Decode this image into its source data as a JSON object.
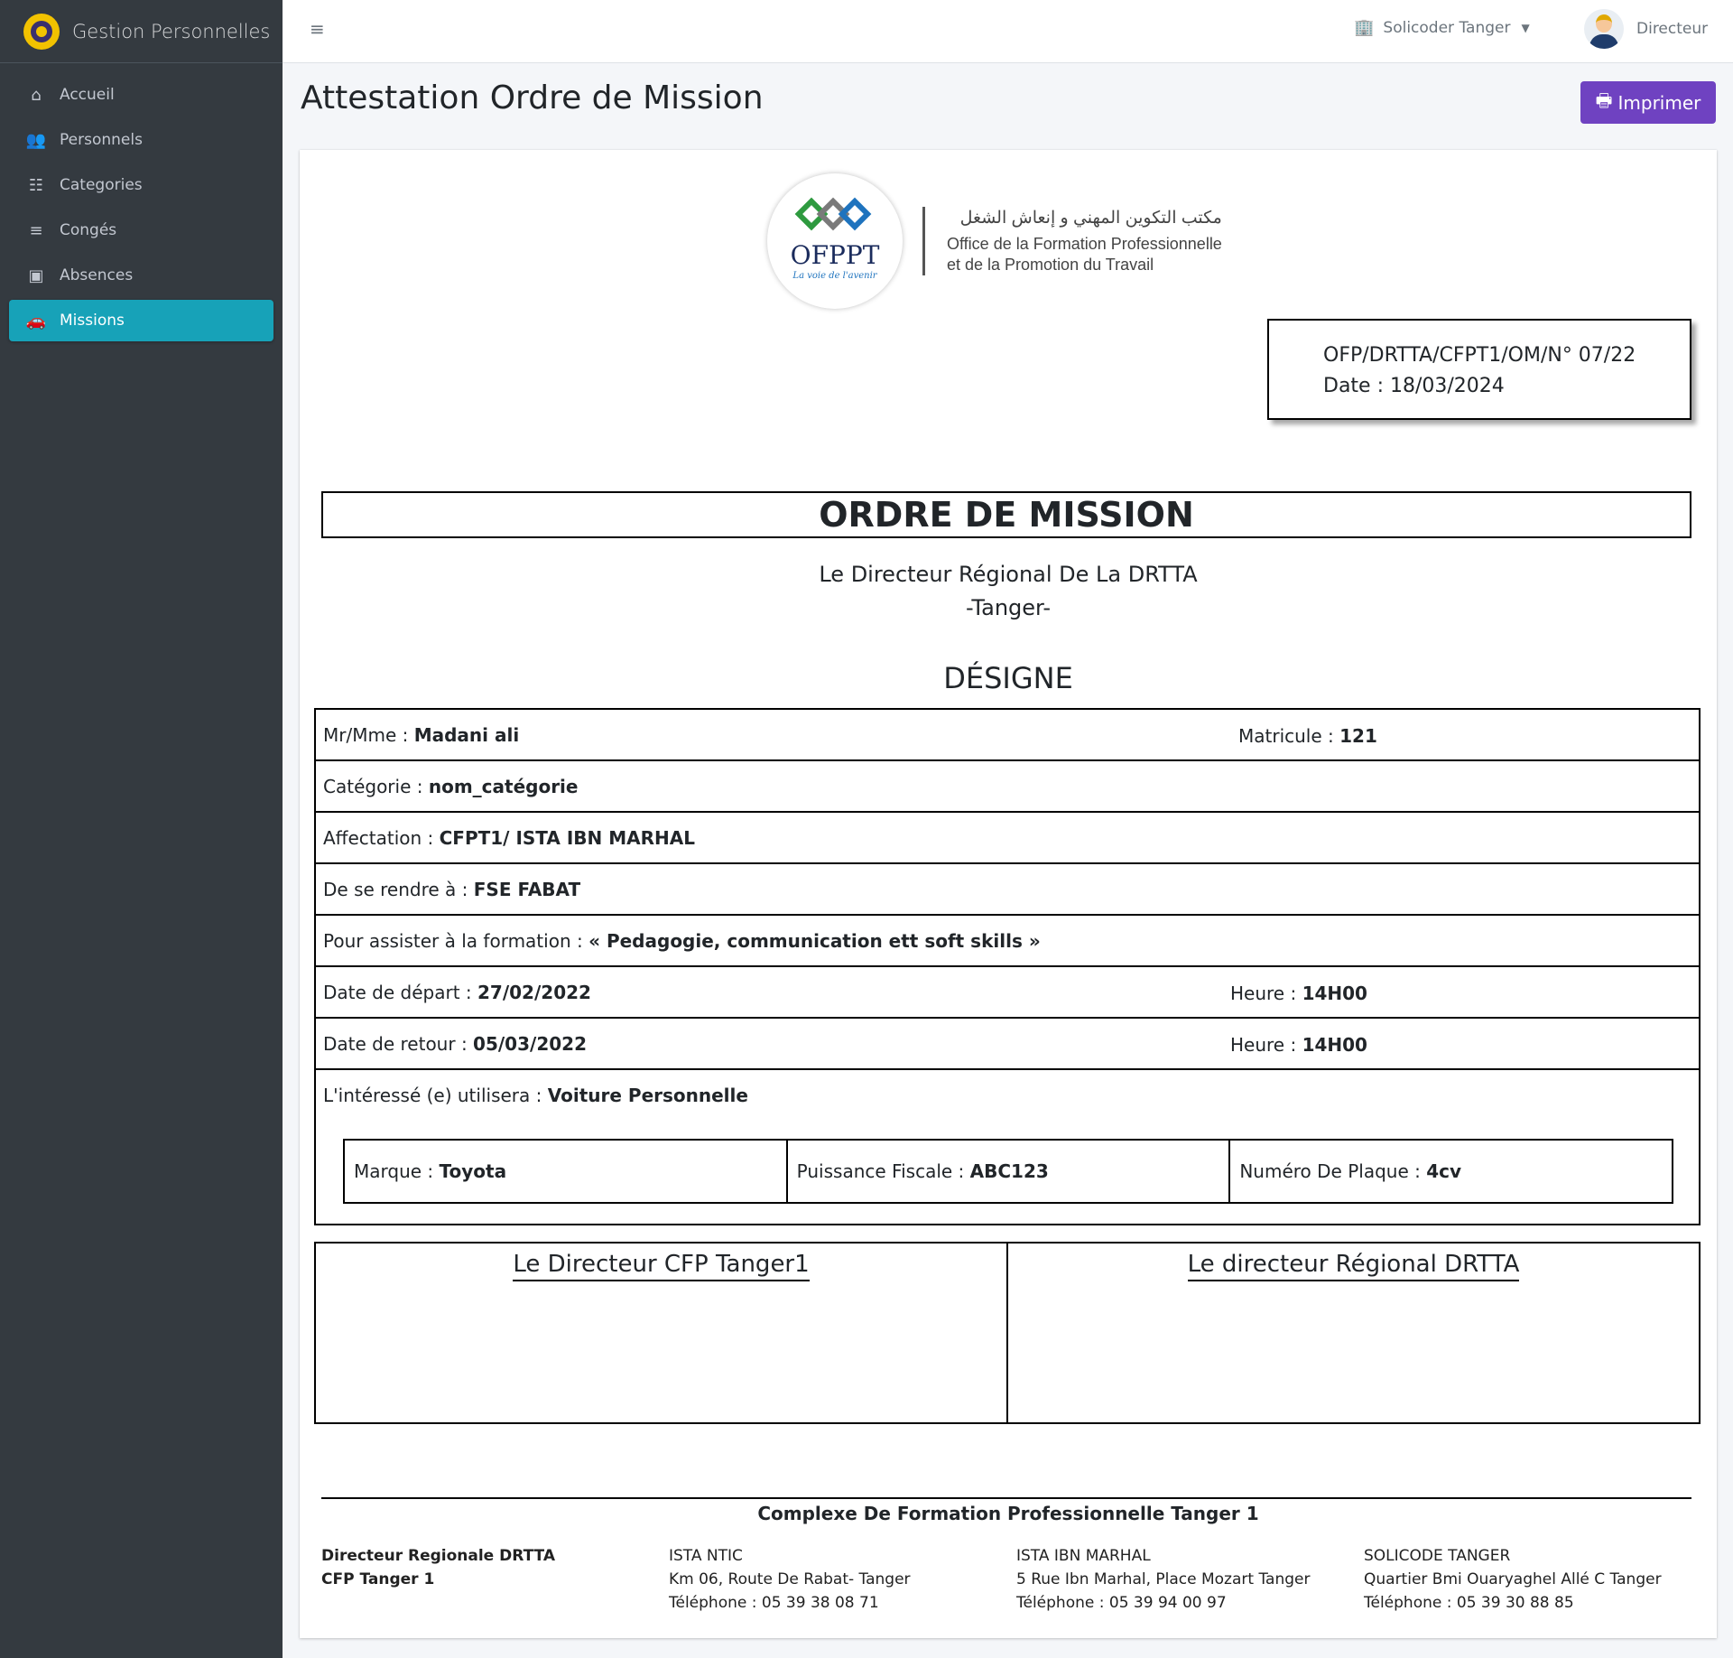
{
  "brand": {
    "name": "Gestion Personnelles"
  },
  "sidebar": {
    "items": [
      {
        "label": "Accueil",
        "icon": "home-icon"
      },
      {
        "label": "Personnels",
        "icon": "users-icon"
      },
      {
        "label": "Categories",
        "icon": "list-icon"
      },
      {
        "label": "Congés",
        "icon": "bars-icon"
      },
      {
        "label": "Absences",
        "icon": "calendar-icon"
      },
      {
        "label": "Missions",
        "icon": "car-icon",
        "active": true
      }
    ]
  },
  "topbar": {
    "location": "Solicoder Tanger",
    "user_role": "Directeur"
  },
  "page": {
    "title": "Attestation Ordre de Mission",
    "print_label": "Imprimer"
  },
  "document": {
    "logo": {
      "name": "OFPPT",
      "tagline": "La voie de l'avenir",
      "arabic": "مكتب التكوين المهني و إنعاش الشغل",
      "french_line1": "Office de la Formation Professionnelle",
      "french_line2": "et de la Promotion du Travail"
    },
    "reference": "OFP/DRTTA/CFPT1/OM/N° 07/22",
    "date_line": "Date : 18/03/2024",
    "title": "ORDRE DE MISSION",
    "director_line1": "Le Directeur Régional De La DRTTA",
    "director_line2": "-Tanger-",
    "designe": "DÉSIGNE",
    "fields": {
      "name_label": "Mr/Mme : ",
      "name_value": "Madani ali",
      "matricule_label": "Matricule : ",
      "matricule_value": "121",
      "categorie_label": "Catégorie : ",
      "categorie_value": "nom_catégorie",
      "affectation_label": "Affectation : ",
      "affectation_value": "CFPT1/ ISTA IBN MARHAL",
      "destination_label": "De se rendre à : ",
      "destination_value": "FSE FABAT",
      "formation_label": "Pour assister à la formation : ",
      "formation_value": "« Pedagogie, communication ett soft skills »",
      "depart_label": "Date de départ : ",
      "depart_value": "27/02/2022",
      "depart_heure_label": "Heure : ",
      "depart_heure_value": "14H00",
      "retour_label": "Date de retour : ",
      "retour_value": "05/03/2022",
      "retour_heure_label": "Heure : ",
      "retour_heure_value": "14H00",
      "transport_label": "L'intéressé (e) utilisera : ",
      "transport_value": "Voiture Personnelle",
      "marque_label": "Marque : ",
      "marque_value": "Toyota",
      "puissance_label": "Puissance Fiscale : ",
      "puissance_value": "ABC123",
      "plaque_label": "Numéro De Plaque : ",
      "plaque_value": "4cv"
    },
    "signatures": {
      "left": "Le Directeur CFP Tanger1",
      "right": "Le directeur Régional DRTTA"
    },
    "footer": {
      "title": "Complexe De Formation Professionnelle Tanger 1",
      "col1_line1": "Directeur Regionale DRTTA",
      "col1_line2": "CFP Tanger 1",
      "col2_line1": "ISTA NTIC",
      "col2_line2": "Km 06, Route De Rabat- Tanger",
      "col2_line3": "Téléphone : 05 39 38 08 71",
      "col3_line1": "ISTA IBN MARHAL",
      "col3_line2": "5 Rue Ibn Marhal, Place Mozart Tanger",
      "col3_line3": "Téléphone : 05 39 94 00 97",
      "col4_line1": "SOLICODE TANGER",
      "col4_line2": "Quartier Bmi Ouaryaghel Allé C Tanger",
      "col4_line3": "Téléphone : 05 39 30 88 85"
    }
  },
  "colors": {
    "sidebar_bg": "#343a40",
    "active_item": "#17a2b8",
    "print_button": "#6f42c1"
  }
}
